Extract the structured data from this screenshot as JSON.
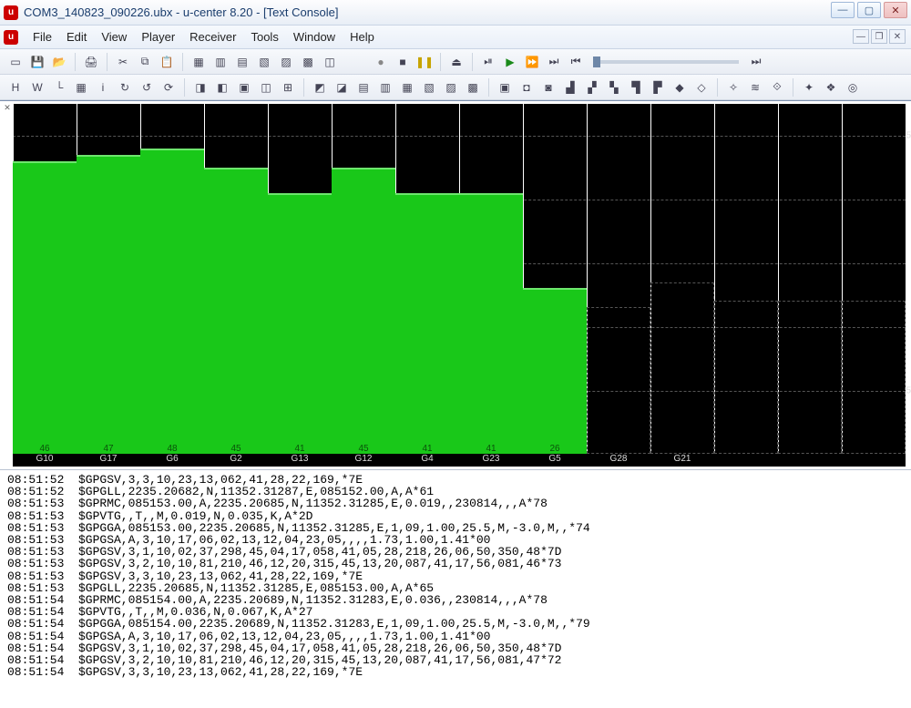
{
  "window": {
    "title": "COM3_140823_090226.ubx - u-center 8.20 - [Text Console]"
  },
  "menu": [
    "File",
    "Edit",
    "View",
    "Player",
    "Receiver",
    "Tools",
    "Window",
    "Help"
  ],
  "toolbar1_icons": [
    "new",
    "save",
    "open",
    "",
    "print",
    "",
    "cut",
    "copy",
    "paste",
    "",
    "tbl1",
    "tbl2",
    "tbl3",
    "tbl4",
    "tbl5",
    "tbl6",
    "tbl7"
  ],
  "player_icons": [
    "rec",
    "stop",
    "pause",
    "",
    "eject",
    "",
    "step-fwd",
    "play",
    "fwd",
    "end",
    "begin"
  ],
  "toolbar2_groups": [
    [
      "hx",
      "w",
      "lt",
      "grid",
      "i",
      "cyc1",
      "cyc2",
      "cyc3"
    ],
    [
      "win1",
      "win2",
      "win3",
      "split1",
      "split2"
    ],
    [
      "panelA",
      "panelB",
      "panelC",
      "panelD",
      "panelE",
      "panelF",
      "panelG",
      "panelH"
    ],
    [
      "v1",
      "v2",
      "v3",
      "v4",
      "v5",
      "v6",
      "v7",
      "v8",
      "v9",
      "v10"
    ],
    [
      "compass",
      "wave",
      "antenna"
    ],
    [
      "tool1",
      "tool2",
      "tool3"
    ]
  ],
  "chart_data": {
    "type": "bar",
    "y_max": 55,
    "tick_labels_right": [
      "5",
      "5"
    ],
    "series": [
      {
        "prn": "G10",
        "cno": 46
      },
      {
        "prn": "G17",
        "cno": 47
      },
      {
        "prn": "G6",
        "cno": 48
      },
      {
        "prn": "G2",
        "cno": 45
      },
      {
        "prn": "G13",
        "cno": 41
      },
      {
        "prn": "G12",
        "cno": 45
      },
      {
        "prn": "G4",
        "cno": 41
      },
      {
        "prn": "G23",
        "cno": 41
      },
      {
        "prn": "G5",
        "cno": 26
      },
      {
        "prn": "G28",
        "cno": 0
      },
      {
        "prn": "G21",
        "cno": 0
      },
      {
        "prn": "",
        "cno": 0
      },
      {
        "prn": "",
        "cno": 0
      },
      {
        "prn": "",
        "cno": 0
      }
    ],
    "empty_marker_heights": [
      0,
      0,
      0,
      0,
      0,
      0,
      0,
      0,
      0,
      23,
      27,
      24,
      24,
      24
    ],
    "grid_h": [
      10,
      20,
      30,
      40,
      50
    ]
  },
  "console": [
    {
      "t": "08:51:52",
      "m": "$GPGSV,3,3,10,23,13,062,41,28,22,169,*7E"
    },
    {
      "t": "08:51:52",
      "m": "$GPGLL,2235.20682,N,11352.31287,E,085152.00,A,A*61"
    },
    {
      "t": "08:51:53",
      "m": "$GPRMC,085153.00,A,2235.20685,N,11352.31285,E,0.019,,230814,,,A*78"
    },
    {
      "t": "08:51:53",
      "m": "$GPVTG,,T,,M,0.019,N,0.035,K,A*2D"
    },
    {
      "t": "08:51:53",
      "m": "$GPGGA,085153.00,2235.20685,N,11352.31285,E,1,09,1.00,25.5,M,-3.0,M,,*74"
    },
    {
      "t": "08:51:53",
      "m": "$GPGSA,A,3,10,17,06,02,13,12,04,23,05,,,,1.73,1.00,1.41*00"
    },
    {
      "t": "08:51:53",
      "m": "$GPGSV,3,1,10,02,37,298,45,04,17,058,41,05,28,218,26,06,50,350,48*7D"
    },
    {
      "t": "08:51:53",
      "m": "$GPGSV,3,2,10,10,81,210,46,12,20,315,45,13,20,087,41,17,56,081,46*73"
    },
    {
      "t": "08:51:53",
      "m": "$GPGSV,3,3,10,23,13,062,41,28,22,169,*7E"
    },
    {
      "t": "08:51:53",
      "m": "$GPGLL,2235.20685,N,11352.31285,E,085153.00,A,A*65"
    },
    {
      "t": "08:51:54",
      "m": "$GPRMC,085154.00,A,2235.20689,N,11352.31283,E,0.036,,230814,,,A*78"
    },
    {
      "t": "08:51:54",
      "m": "$GPVTG,,T,,M,0.036,N,0.067,K,A*27"
    },
    {
      "t": "08:51:54",
      "m": "$GPGGA,085154.00,2235.20689,N,11352.31283,E,1,09,1.00,25.5,M,-3.0,M,,*79"
    },
    {
      "t": "08:51:54",
      "m": "$GPGSA,A,3,10,17,06,02,13,12,04,23,05,,,,1.73,1.00,1.41*00"
    },
    {
      "t": "08:51:54",
      "m": "$GPGSV,3,1,10,02,37,298,45,04,17,058,41,05,28,218,26,06,50,350,48*7D"
    },
    {
      "t": "08:51:54",
      "m": "$GPGSV,3,2,10,10,81,210,46,12,20,315,45,13,20,087,41,17,56,081,47*72"
    },
    {
      "t": "08:51:54",
      "m": "$GPGSV,3,3,10,23,13,062,41,28,22,169,*7E"
    }
  ]
}
